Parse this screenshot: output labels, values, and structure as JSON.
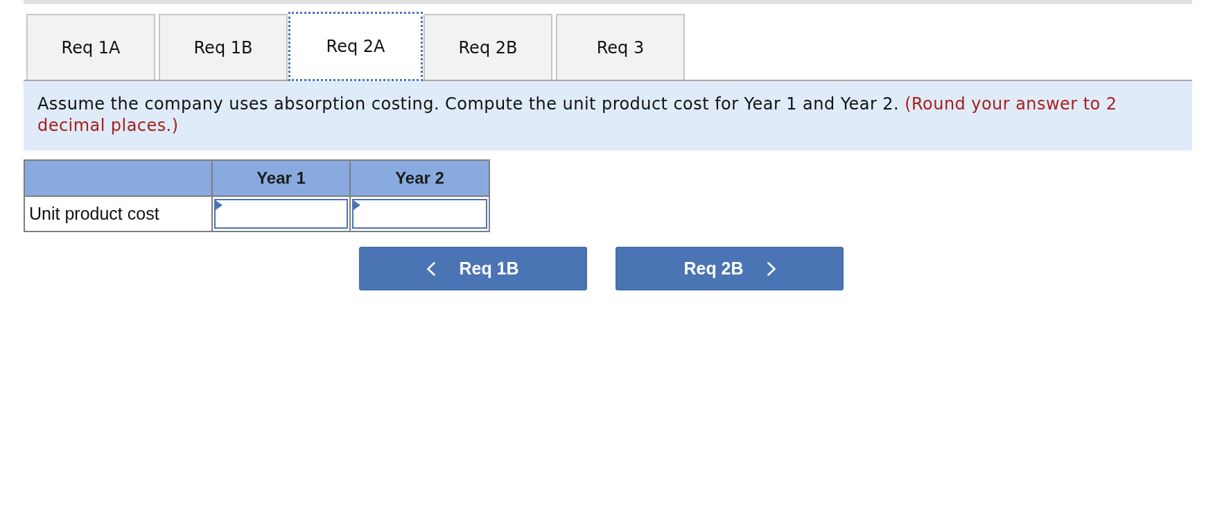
{
  "tabs": [
    {
      "label": "Req 1A",
      "selected": false
    },
    {
      "label": "Req 1B",
      "selected": false
    },
    {
      "label": "Req 2A",
      "selected": true
    },
    {
      "label": "Req 2B",
      "selected": false
    },
    {
      "label": "Req 3",
      "selected": false
    }
  ],
  "instruction": {
    "text": "Assume the company uses absorption costing. Compute the unit product cost for Year 1 and Year 2.",
    "note": "(Round your answer to 2 decimal places.)"
  },
  "table": {
    "columns": [
      "Year 1",
      "Year 2"
    ],
    "rows": [
      {
        "label": "Unit product cost"
      }
    ]
  },
  "navigation": [
    {
      "kind": "previous",
      "label": "Req 1B"
    },
    {
      "kind": "next",
      "label": "Req 2B"
    }
  ]
}
